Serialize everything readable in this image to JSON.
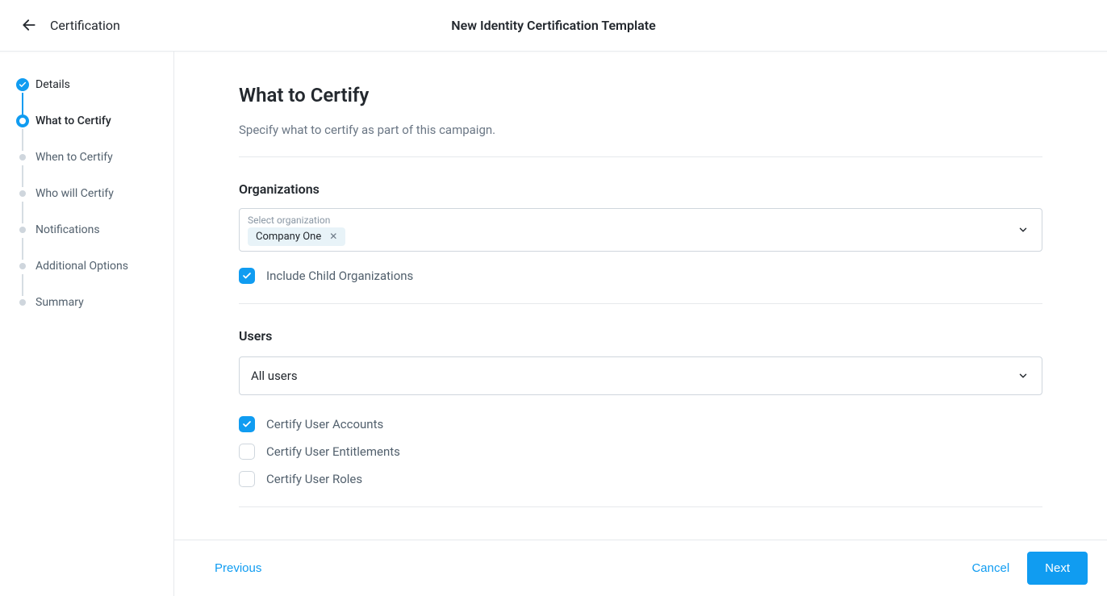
{
  "header": {
    "breadcrumb": "Certification",
    "title": "New Identity Certification Template"
  },
  "stepper": {
    "steps": [
      {
        "label": "Details",
        "state": "completed"
      },
      {
        "label": "What to Certify",
        "state": "current"
      },
      {
        "label": "When to Certify",
        "state": "pending"
      },
      {
        "label": "Who will Certify",
        "state": "pending"
      },
      {
        "label": "Notifications",
        "state": "pending"
      },
      {
        "label": "Additional Options",
        "state": "pending"
      },
      {
        "label": "Summary",
        "state": "pending"
      }
    ]
  },
  "main": {
    "heading": "What to Certify",
    "subtitle": "Specify what to certify as part of this campaign.",
    "organizations": {
      "section_label": "Organizations",
      "placeholder": "Select organization",
      "chips": [
        {
          "label": "Company One"
        }
      ],
      "include_child_label": "Include Child Organizations",
      "include_child_checked": true
    },
    "users": {
      "section_label": "Users",
      "select_value": "All users",
      "options": [
        {
          "label": "Certify User Accounts",
          "checked": true
        },
        {
          "label": "Certify User Entitlements",
          "checked": false
        },
        {
          "label": "Certify User Roles",
          "checked": false
        }
      ]
    }
  },
  "footer": {
    "previous": "Previous",
    "cancel": "Cancel",
    "next": "Next"
  }
}
